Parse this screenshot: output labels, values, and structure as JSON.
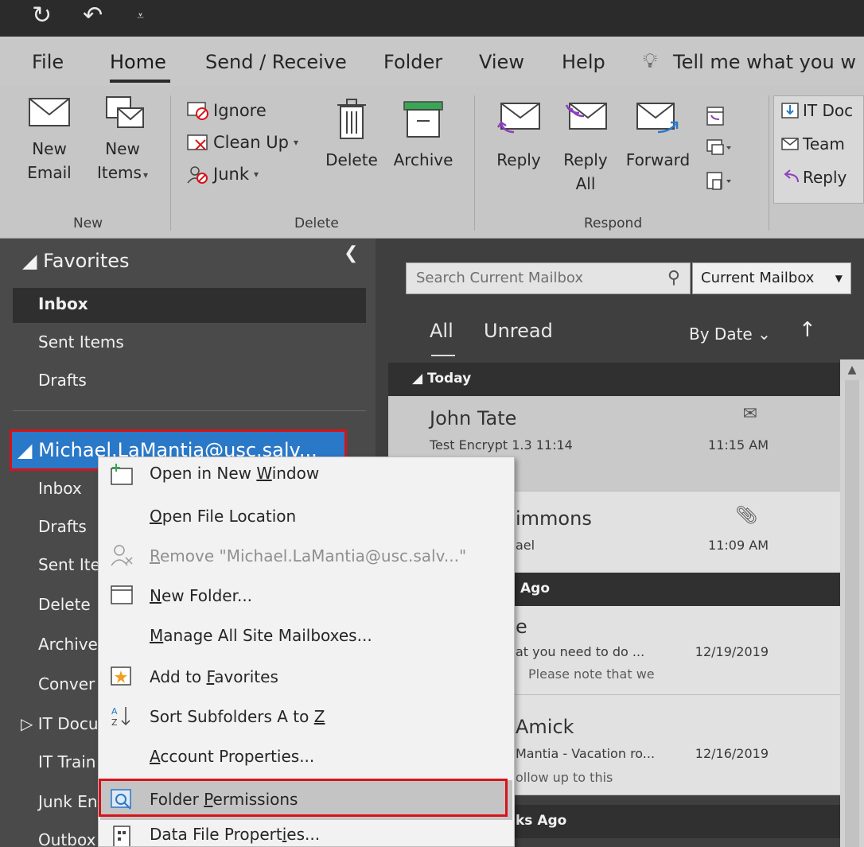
{
  "quick_access": {
    "sync": "↻",
    "undo": "↶",
    "customize": "⩡"
  },
  "tabs": {
    "file": "File",
    "home": "Home",
    "send_receive": "Send / Receive",
    "folder": "Folder",
    "view": "View",
    "help": "Help",
    "tell_me": "Tell me what you w"
  },
  "ribbon": {
    "new_email": [
      "New",
      "Email"
    ],
    "new_items": [
      "New",
      "Items"
    ],
    "ignore": "Ignore",
    "clean_up": "Clean Up",
    "junk": "Junk",
    "delete": "Delete",
    "archive": "Archive",
    "reply": "Reply",
    "reply_all": [
      "Reply",
      "All"
    ],
    "forward": "Forward",
    "quick_steps": [
      "IT Doc",
      "Team",
      "Reply"
    ],
    "groups": {
      "new": "New",
      "delete": "Delete",
      "respond": "Respond"
    }
  },
  "nav": {
    "favorites": "Favorites",
    "fav_items": [
      "Inbox",
      "Sent Items",
      "Drafts"
    ],
    "account": "Michael.LaMantia@usc.salv...",
    "account_items": [
      "Inbox",
      "Drafts",
      "Sent Ite",
      "Delete",
      "Archive",
      "Conver",
      "IT Docu",
      "IT Train",
      "Junk En",
      "Outbox"
    ]
  },
  "list": {
    "search_placeholder": "Search Current Mailbox",
    "scope": "Current Mailbox",
    "filter_all": "All",
    "filter_unread": "Unread",
    "sort": "By Date",
    "groups": [
      "Today",
      "Ago",
      "ks Ago"
    ],
    "messages": [
      {
        "from": "John Tate",
        "subject": "Test Encrypt 1.3 11:14",
        "preview": "",
        "time": "11:15 AM"
      },
      {
        "from": "immons",
        "subject": "ael",
        "preview": "",
        "time": "11:09 AM"
      },
      {
        "from": "e",
        "subject": "at you need to do ...",
        "preview": "Please note that we",
        "time": "12/19/2019"
      },
      {
        "from": "Amick",
        "subject": "Mantia - Vacation ro...",
        "preview": "ollow up to this",
        "time": "12/16/2019"
      }
    ]
  },
  "context_menu": {
    "items": [
      {
        "pre": "Open in New ",
        "key": "W",
        "post": "indow"
      },
      {
        "pre": "",
        "key": "O",
        "post": "pen File Location"
      },
      {
        "pre": "",
        "key": "R",
        "post": "emove \"Michael.LaMantia@usc.salv...\""
      },
      {
        "pre": "",
        "key": "N",
        "post": "ew Folder..."
      },
      {
        "pre": "",
        "key": "M",
        "post": "anage All Site Mailboxes..."
      },
      {
        "pre": "Add to ",
        "key": "F",
        "post": "avorites"
      },
      {
        "pre": "Sort Subfolders A to ",
        "key": "Z",
        "post": ""
      },
      {
        "pre": "",
        "key": "A",
        "post": "ccount Properties..."
      },
      {
        "pre": "Folder ",
        "key": "P",
        "post": "ermissions"
      },
      {
        "pre": "Data File Propert",
        "key": "i",
        "post": "es..."
      }
    ]
  },
  "colors": {
    "accent_blue": "#2a78c8",
    "highlight_red": "#d7131a"
  }
}
